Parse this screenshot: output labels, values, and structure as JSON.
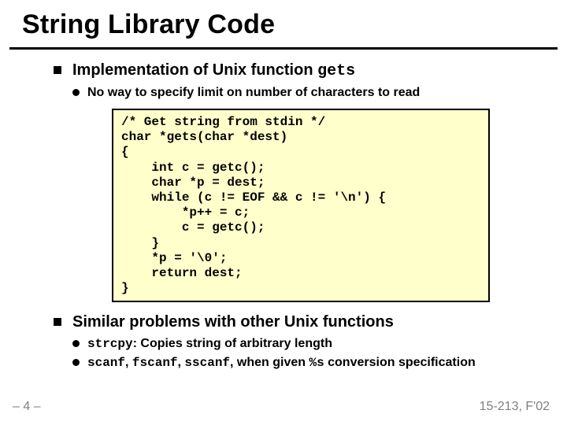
{
  "title": "String Library Code",
  "bullets": [
    {
      "text_pre": "Implementation of Unix function ",
      "text_code": "gets",
      "sub": [
        {
          "text": "No way to specify limit on number of characters to read"
        }
      ],
      "code": "/* Get string from stdin */\nchar *gets(char *dest)\n{\n    int c = getc();\n    char *p = dest;\n    while (c != EOF && c != '\\n') {\n        *p++ = c;\n        c = getc();\n    }\n    *p = '\\0';\n    return dest;\n}"
    },
    {
      "text": "Similar problems with other Unix functions",
      "sub": [
        {
          "code": "strcpy",
          "after": ": Copies string of arbitrary length"
        },
        {
          "code1": "scanf",
          "mid1": ", ",
          "code2": "fscanf",
          "mid2": ", ",
          "code3": "sscanf",
          "after1": ", when given ",
          "code4": "%s",
          "after2": " conversion specification"
        }
      ]
    }
  ],
  "footer": {
    "left": "– 4 –",
    "right": "15-213, F'02"
  }
}
